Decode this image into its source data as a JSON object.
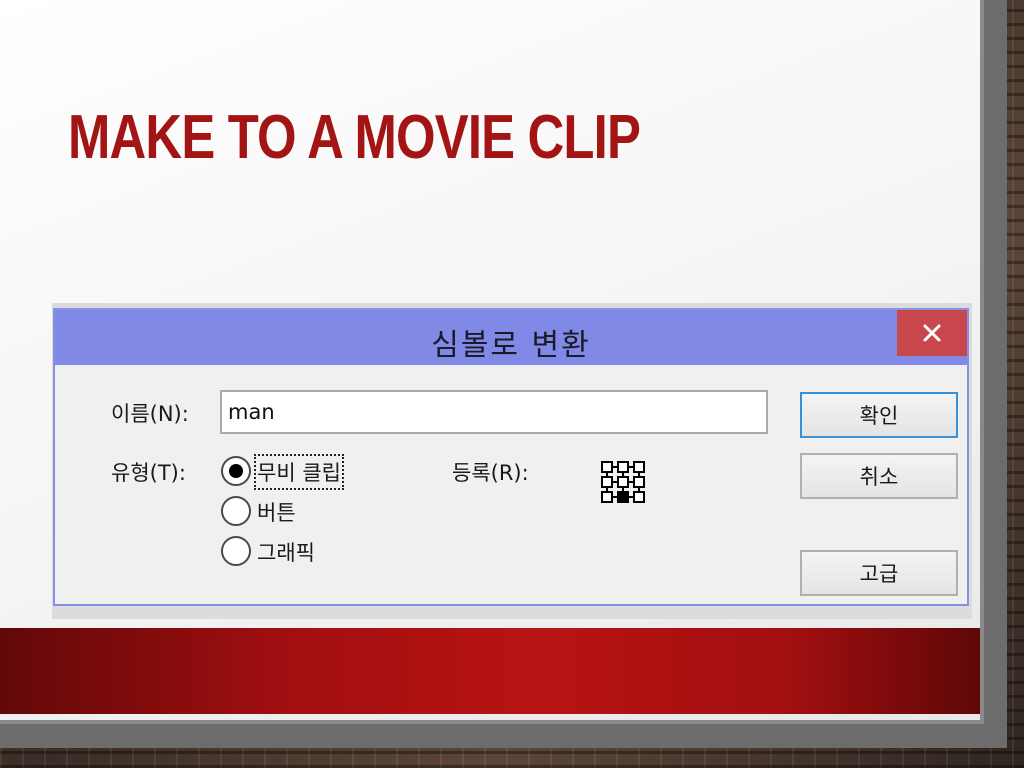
{
  "slide": {
    "title": "MAKE TO A MOVIE CLIP"
  },
  "dialog": {
    "title": "심볼로 변환",
    "close_glyph": "✕",
    "name_label": "이름(N):",
    "name_value": "man",
    "type_label": "유형(T):",
    "type_options": [
      {
        "label": "무비 클립",
        "selected": true
      },
      {
        "label": "버튼",
        "selected": false
      },
      {
        "label": "그래픽",
        "selected": false
      }
    ],
    "registration_label": "등록(R):",
    "buttons": {
      "ok": "확인",
      "cancel": "취소",
      "advanced": "고급"
    }
  },
  "colors": {
    "title_red": "#a31414",
    "titlebar": "#8089e6",
    "close_button": "#c7474c",
    "default_button_border": "#3b8fd6",
    "band_red": "#b81414"
  },
  "icons": {
    "close": "close-icon",
    "registration": "registration-point-grid-icon"
  }
}
